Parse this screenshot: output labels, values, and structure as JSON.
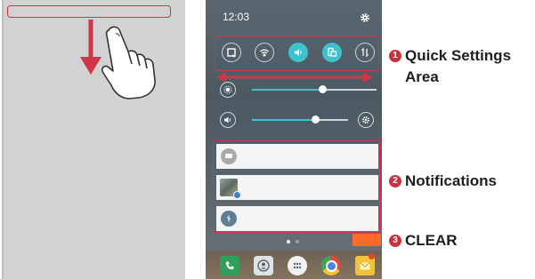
{
  "phone": {
    "time": "12:03"
  },
  "callouts": [
    {
      "number": "1",
      "line1": "Quick Settings",
      "line2": "Area"
    },
    {
      "number": "2",
      "line1": "Notifications"
    },
    {
      "number": "3",
      "line1": "CLEAR"
    }
  ],
  "colors": {
    "highlight": "#d23448",
    "accent": "#3ec2cc",
    "clear_button": "#ff6a2b",
    "callout_badge": "#c8323f"
  },
  "quick_settings": [
    {
      "icon": "screenshot-icon",
      "active": false
    },
    {
      "icon": "wifi-icon",
      "active": false
    },
    {
      "icon": "sound-icon",
      "active": true
    },
    {
      "icon": "rotation-icon",
      "active": true
    },
    {
      "icon": "data-icon",
      "active": false
    }
  ],
  "sliders": [
    {
      "icon": "brightness-icon",
      "level": 0.63
    },
    {
      "icon": "volume-icon",
      "level": 0.68
    }
  ],
  "notifications": [
    {
      "icon": "message-icon"
    },
    {
      "icon": "photo-icon"
    },
    {
      "icon": "usb-icon"
    }
  ],
  "dock": [
    "phone-icon",
    "contacts-icon",
    "apps-icon",
    "chrome-icon",
    "email-icon"
  ]
}
